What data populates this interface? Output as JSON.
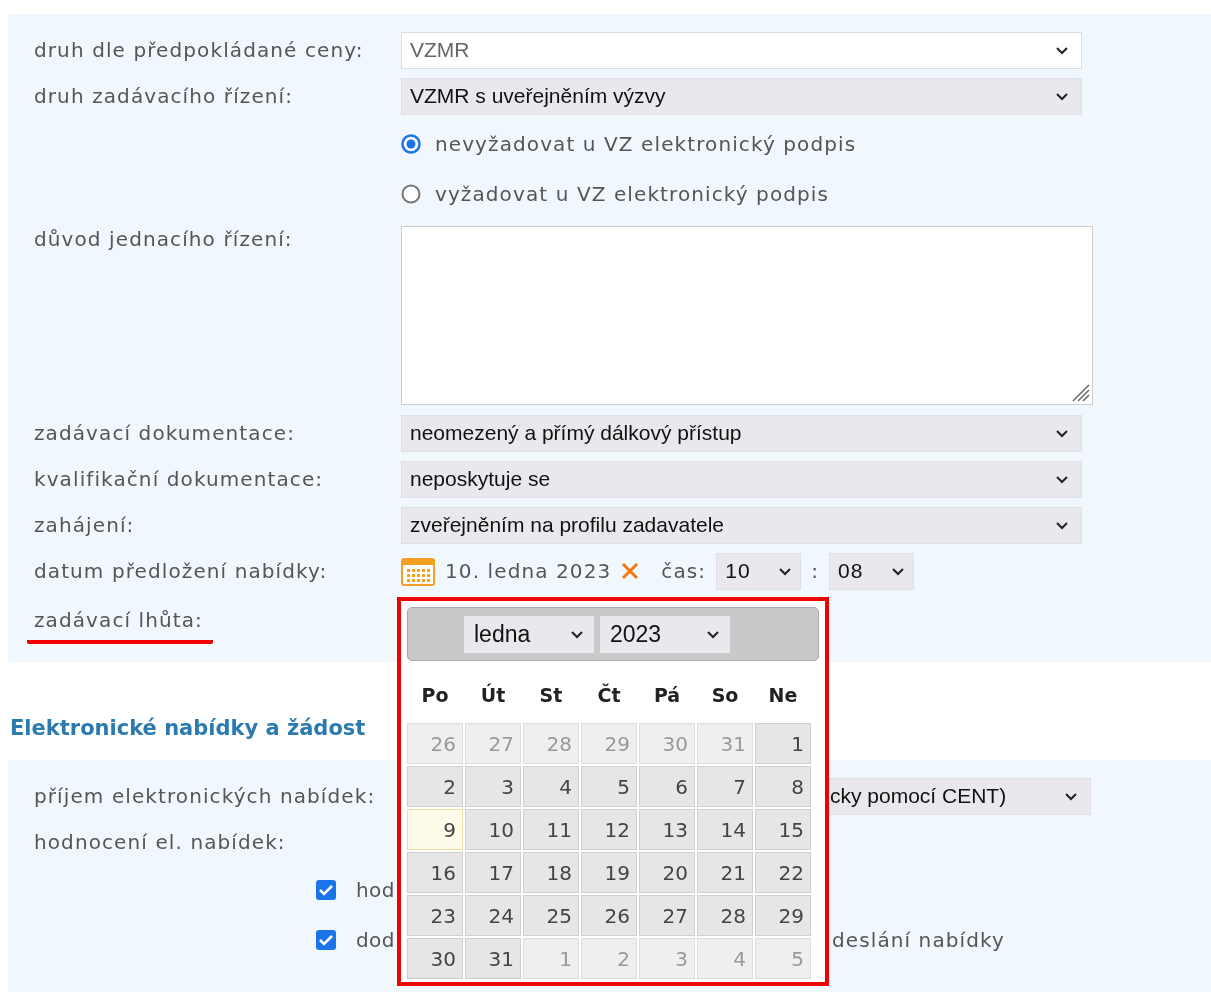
{
  "form": {
    "rows": [
      {
        "kind": "select",
        "label": "druh dle předpokládané ceny:",
        "value": "VZMR",
        "disabled": true
      },
      {
        "kind": "select",
        "label": "druh zadávacího řízení:",
        "value": "VZMR s uveřejněním výzvy",
        "disabled": false
      },
      {
        "kind": "radio",
        "options": [
          {
            "label": "nevyžadovat u VZ elektronický podpis",
            "selected": true
          },
          {
            "label": "vyžadovat u VZ elektronický podpis",
            "selected": false
          }
        ]
      },
      {
        "kind": "textarea",
        "label": "důvod jednacího řízení:"
      },
      {
        "kind": "select",
        "label": "zadávací dokumentace:",
        "value": "neomezený a přímý dálkový přístup",
        "disabled": false
      },
      {
        "kind": "select",
        "label": "kvalifikační dokumentace:",
        "value": "neposkytuje se",
        "disabled": false
      },
      {
        "kind": "select",
        "label": "zahájení:",
        "value": "zveřejněním na profilu zadavatele",
        "disabled": false
      },
      {
        "kind": "date",
        "label": "datum předložení nabídky:",
        "date": "10. ledna 2023",
        "time_label": "čas:",
        "hour": "10",
        "separator": ":",
        "minute": "08"
      },
      {
        "kind": "label",
        "label": "zadávací lhůta:",
        "underlined": true
      }
    ]
  },
  "section": {
    "title": "Elektronické nabídky a žádost",
    "rows": [
      {
        "kind": "select",
        "label": "příjem elektronických nabídek:",
        "value": "cky pomocí CENT)",
        "disabled": false
      },
      {
        "kind": "label",
        "label": "hodnocení el. nabídek:",
        "underlined": false
      },
      {
        "kind": "checkbox",
        "label": "hod",
        "checked": true
      },
      {
        "kind": "checkbox",
        "label": "dod",
        "checked": true,
        "tail": "deslání nabídky"
      }
    ]
  },
  "calendar": {
    "month": "ledna",
    "year": "2023",
    "weekdays": [
      "Po",
      "Út",
      "St",
      "Čt",
      "Pá",
      "So",
      "Ne"
    ],
    "weeks": [
      [
        {
          "day": "26",
          "outside": true,
          "today": false
        },
        {
          "day": "27",
          "outside": true,
          "today": false
        },
        {
          "day": "28",
          "outside": true,
          "today": false
        },
        {
          "day": "29",
          "outside": true,
          "today": false
        },
        {
          "day": "30",
          "outside": true,
          "today": false
        },
        {
          "day": "31",
          "outside": true,
          "today": false
        },
        {
          "day": "1",
          "outside": false,
          "today": false
        }
      ],
      [
        {
          "day": "2",
          "outside": false,
          "today": false
        },
        {
          "day": "3",
          "outside": false,
          "today": false
        },
        {
          "day": "4",
          "outside": false,
          "today": false
        },
        {
          "day": "5",
          "outside": false,
          "today": false
        },
        {
          "day": "6",
          "outside": false,
          "today": false
        },
        {
          "day": "7",
          "outside": false,
          "today": false
        },
        {
          "day": "8",
          "outside": false,
          "today": false
        }
      ],
      [
        {
          "day": "9",
          "outside": false,
          "today": true
        },
        {
          "day": "10",
          "outside": false,
          "today": false
        },
        {
          "day": "11",
          "outside": false,
          "today": false
        },
        {
          "day": "12",
          "outside": false,
          "today": false
        },
        {
          "day": "13",
          "outside": false,
          "today": false
        },
        {
          "day": "14",
          "outside": false,
          "today": false
        },
        {
          "day": "15",
          "outside": false,
          "today": false
        }
      ],
      [
        {
          "day": "16",
          "outside": false,
          "today": false
        },
        {
          "day": "17",
          "outside": false,
          "today": false
        },
        {
          "day": "18",
          "outside": false,
          "today": false
        },
        {
          "day": "19",
          "outside": false,
          "today": false
        },
        {
          "day": "20",
          "outside": false,
          "today": false
        },
        {
          "day": "21",
          "outside": false,
          "today": false
        },
        {
          "day": "22",
          "outside": false,
          "today": false
        }
      ],
      [
        {
          "day": "23",
          "outside": false,
          "today": false
        },
        {
          "day": "24",
          "outside": false,
          "today": false
        },
        {
          "day": "25",
          "outside": false,
          "today": false
        },
        {
          "day": "26",
          "outside": false,
          "today": false
        },
        {
          "day": "27",
          "outside": false,
          "today": false
        },
        {
          "day": "28",
          "outside": false,
          "today": false
        },
        {
          "day": "29",
          "outside": false,
          "today": false
        }
      ],
      [
        {
          "day": "30",
          "outside": false,
          "today": false
        },
        {
          "day": "31",
          "outside": false,
          "today": false
        },
        {
          "day": "1",
          "outside": true,
          "today": false
        },
        {
          "day": "2",
          "outside": true,
          "today": false
        },
        {
          "day": "3",
          "outside": true,
          "today": false
        },
        {
          "day": "4",
          "outside": true,
          "today": false
        },
        {
          "day": "5",
          "outside": true,
          "today": false
        }
      ]
    ]
  }
}
